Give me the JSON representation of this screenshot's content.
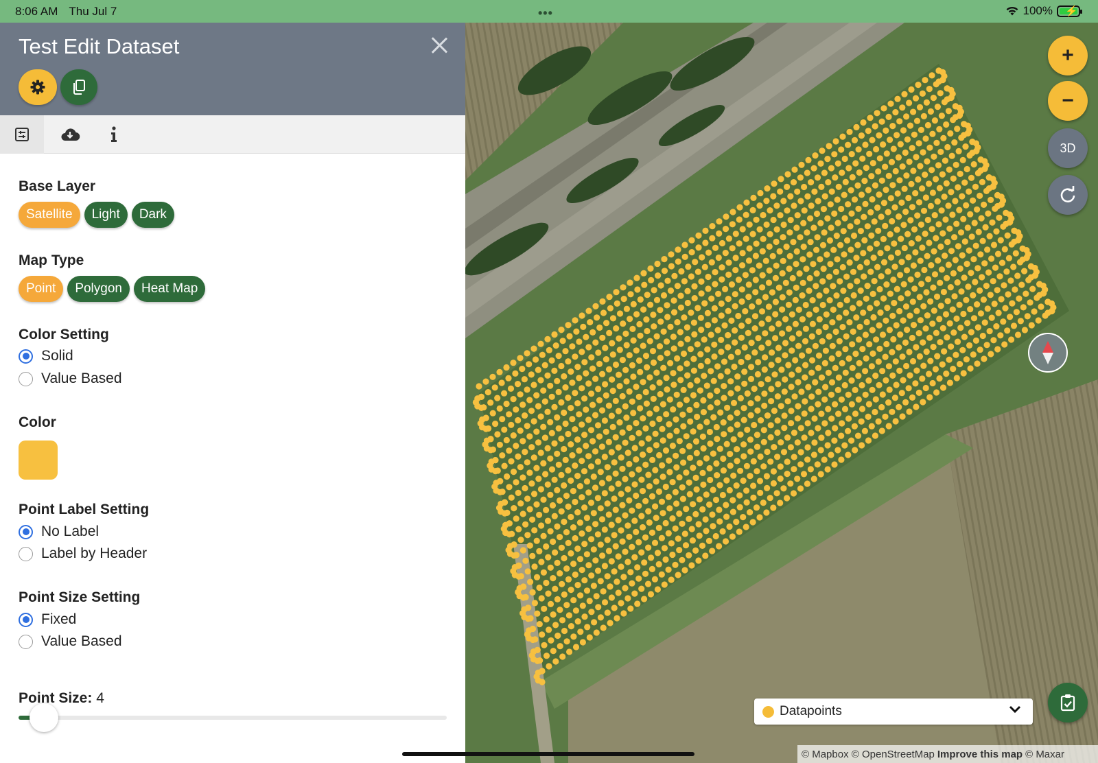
{
  "status": {
    "time": "8:06 AM",
    "date": "Thu Jul 7",
    "battery": "100%",
    "dots": "•••"
  },
  "panel": {
    "title": "Test Edit Dataset",
    "base_layer": {
      "title": "Base Layer",
      "options": [
        "Satellite",
        "Light",
        "Dark"
      ],
      "selected": "Satellite"
    },
    "map_type": {
      "title": "Map Type",
      "options": [
        "Point",
        "Polygon",
        "Heat Map"
      ],
      "selected": "Point"
    },
    "color_setting": {
      "title": "Color Setting",
      "options": [
        "Solid",
        "Value Based"
      ],
      "selected": "Solid"
    },
    "color": {
      "title": "Color",
      "value": "#f7c040"
    },
    "point_label": {
      "title": "Point Label Setting",
      "options": [
        "No Label",
        "Label by Header"
      ],
      "selected": "No Label"
    },
    "point_size_setting": {
      "title": "Point Size Setting",
      "options": [
        "Fixed",
        "Value Based"
      ],
      "selected": "Fixed"
    },
    "point_size": {
      "label": "Point Size:",
      "value": "4"
    }
  },
  "map": {
    "buttons": {
      "zoom_in": "+",
      "zoom_out": "−",
      "three_d": "3D"
    },
    "layer_dropdown": {
      "label": "Datapoints"
    },
    "attribution": {
      "mapbox": "© Mapbox",
      "osm": "© OpenStreetMap",
      "improve": "Improve this map",
      "maxar": "© Maxar"
    },
    "point_color": "#f7c040"
  }
}
